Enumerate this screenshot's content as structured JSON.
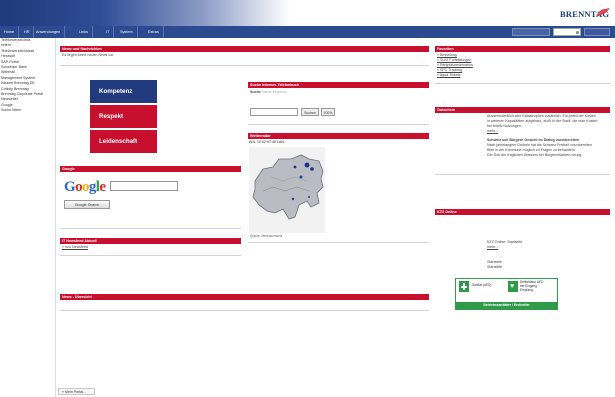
{
  "nav": {
    "items": [
      "Home",
      "HR",
      "Anwendungen",
      "Links",
      "IT",
      "System",
      "Extras"
    ]
  },
  "logo": {
    "text": "BRENNTAG"
  },
  "sidebar": {
    "links": [
      "Telefonverzeichnis",
      "extern",
      "Telefonverzeichnisse",
      "Hexasoft",
      "SAP-Portal",
      "Schweizer Bank",
      "Webmail",
      "Management System",
      "Intranet Brenntag DE",
      "Cofinity Brenntag",
      "Brenntag Corporate Portal",
      "Newsletter",
      "Google",
      "Suche Intern"
    ],
    "back_link": "« Mein Portal..."
  },
  "news": {
    "title": "News und Nachrichten",
    "empty": "Es liegen keine neuen News vor."
  },
  "brand": {
    "line1": "Kompetenz",
    "line2": "Respekt",
    "line3": "Leidenschaft"
  },
  "google": {
    "title": "Google",
    "logo_letters": [
      "G",
      "o",
      "o",
      "g",
      "l",
      "e"
    ],
    "button": "Google Search"
  },
  "telephone": {
    "title": "Suche internes Telefonbuch",
    "label": "Suche",
    "hint": "Name eingeben",
    "search_button": "Suchen",
    "count_button": "100%"
  },
  "weather": {
    "title": "Wetterradar",
    "stamp": "ADL 10.02 97:40 LAN",
    "source": "Quelle: Meteoschweiz"
  },
  "it_news": {
    "title": "IT Newsfeed Aktuell",
    "link": "» neu Newsfeed"
  },
  "news_overview": {
    "title": "News - Übersicht"
  },
  "favorites": {
    "title": "Favoriten",
    "links": [
      "Bestellung",
      "SUVI Fortbildungen",
      "Parkplatzreservation",
      "SPC Tracking",
      "Aqua Tickets"
    ]
  },
  "notice": {
    "title": "Gutschein",
    "lines": [
      "Ausserordentlich wird Katastrophen zusätzlich. Ein Anteil der Kosten",
      "in weiteren Kapazitäten aufgebaut, auch in der Stadt, die man Kosten",
      "bei relativ Nutzungen.",
      "mehr..."
    ],
    "lines2": [
      "Schweiz soll Bürgern Gesicht im Dialog vorzubereiten",
      "Nach jahrelangem Grübeln hat die Schweiz Freiheit vorzubereiten",
      "Bitte in der Kommune möglich zu Fragen zu behandeln",
      "Der Sub der fraglichen Dossiers bei Bürgerinitiativen herzig."
    ]
  },
  "kzz": {
    "title": "KZZ Online",
    "heading": "KZZ Online: Startseite",
    "more": "mehr...",
    "line1": "Startseite",
    "line2": "Startseite"
  },
  "aed": {
    "left_label": "Sanität (AED)",
    "right_label_1": "Defibrillator AED",
    "right_label_2": "bei Eingang",
    "right_label_3": "Empfang",
    "footer": "Betriebssanitäter / Ersthelfer"
  },
  "colors": {
    "nav_blue": "#2c4a8f",
    "brand_blue": "#213b7e",
    "brand_red": "#c8102e",
    "aed_green": "#2f9a47"
  }
}
